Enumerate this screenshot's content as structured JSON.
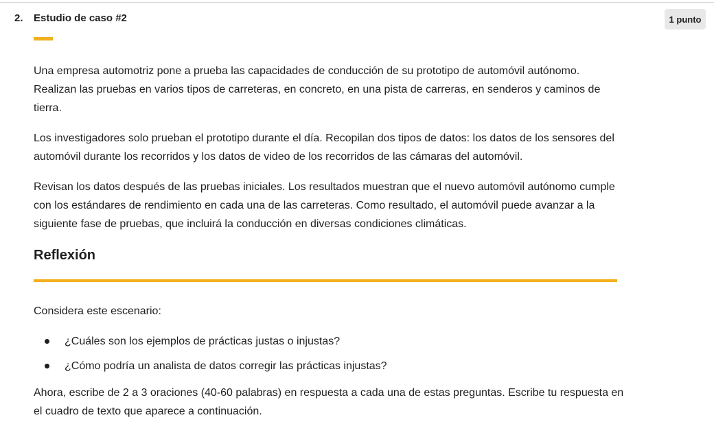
{
  "question": {
    "number": "2.",
    "title": "Estudio de caso #2",
    "points": "1 punto"
  },
  "case_study": {
    "paragraphs": [
      "Una empresa automotriz pone a prueba las capacidades de conducción de su prototipo de automóvil autónomo. Realizan las pruebas en varios tipos de carreteras, en concreto, en una pista de carreras, en senderos y caminos de tierra.",
      "Los investigadores solo prueban el prototipo durante el día. Recopilan dos tipos de datos: los datos de los sensores del automóvil durante los recorridos y los datos de video de los recorridos de las cámaras del automóvil.",
      "Revisan los datos después de las pruebas iniciales. Los resultados muestran que el nuevo automóvil autónomo cumple con los estándares de rendimiento en cada una de las carreteras. Como resultado, el automóvil puede avanzar a la siguiente fase de pruebas, que incluirá la conducción en diversas condiciones climáticas."
    ]
  },
  "reflection": {
    "heading": "Reflexión",
    "intro": "Considera este escenario:",
    "bullets": [
      "¿Cuáles son los ejemplos de prácticas justas o injustas?",
      "¿Cómo podría un analista de datos corregir las prácticas injustas?"
    ],
    "closing": "Ahora, escribe de 2 a 3 oraciones (40-60 palabras) en respuesta a cada una de estas preguntas. Escribe tu respuesta en el cuadro de texto que aparece a continuación."
  },
  "colors": {
    "accent": "#f2b01e",
    "badge_bg": "#e8e8e8",
    "text": "#1f1f1f"
  }
}
